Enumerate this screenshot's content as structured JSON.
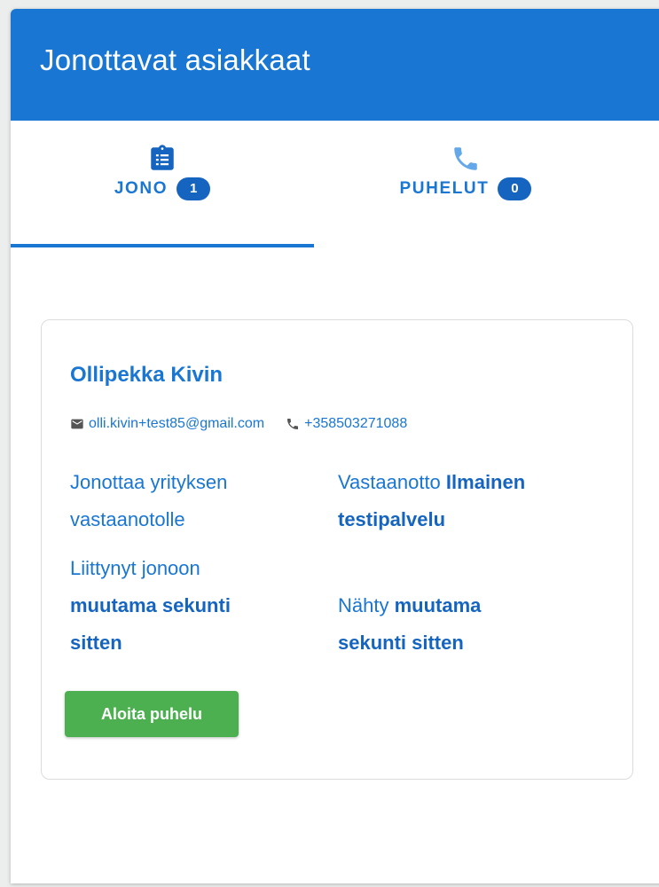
{
  "header": {
    "title": "Jonottavat asiakkaat"
  },
  "colors": {
    "primary": "#1976d2",
    "primary_dark": "#1565c0",
    "success": "#4caf50"
  },
  "tabs": [
    {
      "label": "JONO",
      "badge": "1",
      "icon": "clipboard-list-icon",
      "active": true
    },
    {
      "label": "PUHELUT",
      "badge": "0",
      "icon": "phone-icon",
      "active": false
    }
  ],
  "customer": {
    "name": "Ollipekka Kivin",
    "email": "olli.kivin+test85@gmail.com",
    "phone": "+358503271088",
    "queue_text_line1": "Jonottaa yrityksen",
    "queue_text_line2": "vastaanotolle",
    "reception_label": "Vastaanotto",
    "reception_name_line1": "Ilmainen",
    "reception_name_line2": "testipalvelu",
    "joined_label": "Liittynyt jonoon",
    "joined_value_line1": "muutama sekunti",
    "joined_value_line2": "sitten",
    "seen_label": "Nähty",
    "seen_value_line1": "muutama",
    "seen_value_line2": "sekunti sitten"
  },
  "actions": {
    "start_call_label": "Aloita puhelu"
  }
}
